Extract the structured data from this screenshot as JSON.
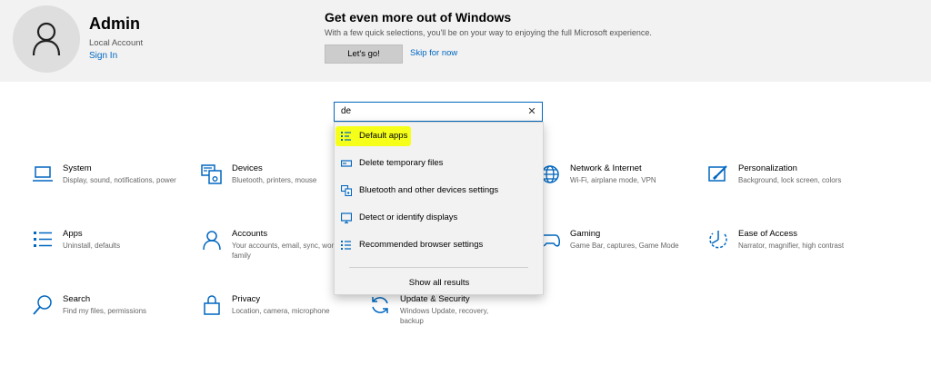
{
  "account": {
    "name": "Admin",
    "type": "Local Account",
    "signin_label": "Sign In"
  },
  "promo": {
    "title": "Get even more out of Windows",
    "description": "With a few quick selections, you'll be on your way to enjoying the full Microsoft experience.",
    "primary_button": "Let's go!",
    "skip_link": "Skip for now"
  },
  "search": {
    "value": "de",
    "clear_icon": "close-icon"
  },
  "suggestions": {
    "items": [
      {
        "label": "Default apps",
        "icon": "default-apps-icon",
        "highlighted": true
      },
      {
        "label": "Delete temporary files",
        "icon": "storage-icon"
      },
      {
        "label": "Bluetooth and other devices settings",
        "icon": "devices-icon"
      },
      {
        "label": "Detect or identify displays",
        "icon": "display-icon"
      },
      {
        "label": "Recommended browser settings",
        "icon": "apps-list-icon"
      }
    ],
    "show_all": "Show all results"
  },
  "categories": {
    "items": [
      {
        "name": "System",
        "description": "Display, sound, notifications, power",
        "icon": "laptop-icon"
      },
      {
        "name": "Devices",
        "description": "Bluetooth, printers, mouse",
        "icon": "keyboard-icon"
      },
      {
        "name": "Network & Internet",
        "description": "Wi-Fi, airplane mode, VPN",
        "icon": "globe-icon"
      },
      {
        "name": "Personalization",
        "description": "Background, lock screen, colors",
        "icon": "paint-icon"
      },
      {
        "name": "Apps",
        "description": "Uninstall, defaults",
        "icon": "apps-list-icon"
      },
      {
        "name": "Accounts",
        "description": "Your accounts, email, sync, work, family",
        "icon": "person-icon"
      },
      {
        "name": "Gaming",
        "description": "Game Bar, captures, Game Mode",
        "icon": "gamepad-icon"
      },
      {
        "name": "Ease of Access",
        "description": "Narrator, magnifier, high contrast",
        "icon": "ease-of-access-icon"
      },
      {
        "name": "Search",
        "description": "Find my files, permissions",
        "icon": "search-icon"
      },
      {
        "name": "Privacy",
        "description": "Location, camera, microphone",
        "icon": "lock-icon"
      },
      {
        "name": "Update & Security",
        "description": "Windows Update, recovery, backup",
        "icon": "sync-icon"
      }
    ]
  },
  "colors": {
    "accent": "#0067c0",
    "highlight": "#f6ff1a",
    "banner_bg": "#f2f2f2"
  }
}
